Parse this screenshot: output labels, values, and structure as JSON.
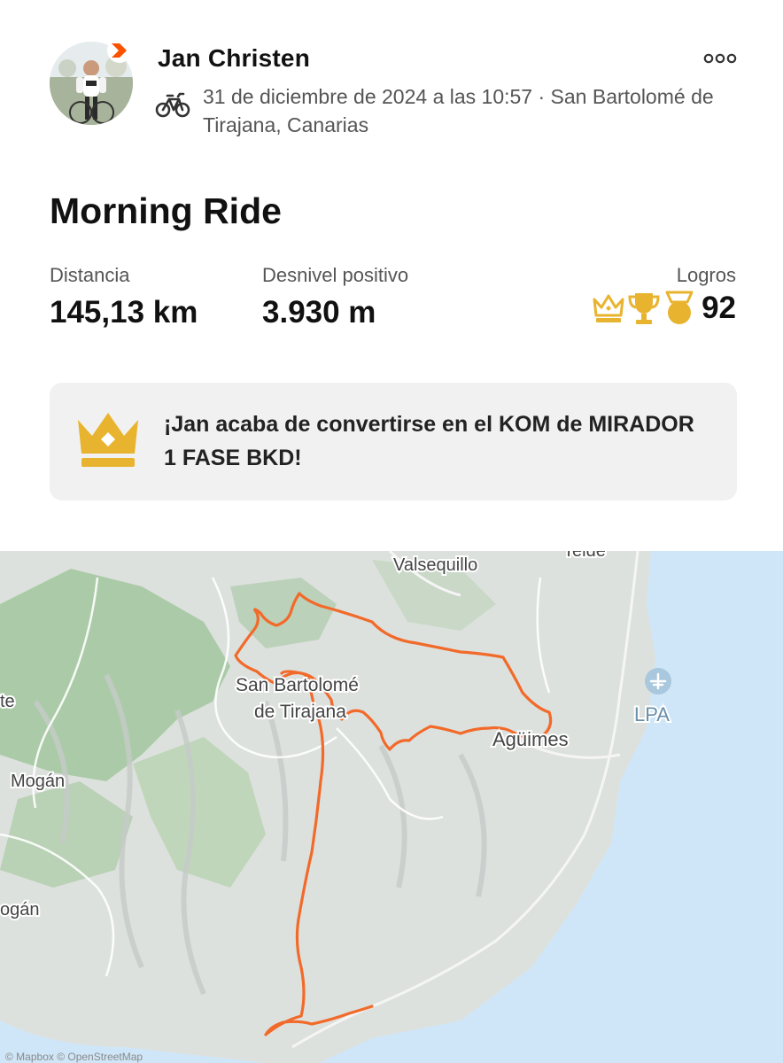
{
  "athlete": {
    "name": "Jan Christen",
    "meta": "31 de diciembre de 2024 a las 10:57 · San Bartolomé de Tirajana, Canarias"
  },
  "activity": {
    "title": "Morning Ride",
    "distance": {
      "label": "Distancia",
      "value": "145,13 km"
    },
    "elevation": {
      "label": "Desnivel positivo",
      "value": "3.930 m"
    },
    "achievements": {
      "label": "Logros",
      "count": "92",
      "icons": [
        "crown-icon",
        "trophy-icon",
        "medal-icon"
      ]
    }
  },
  "kom_banner": {
    "text": "¡Jan acaba de convertirse en el KOM de MIRADOR 1 FASE BKD!",
    "icon": "crown-icon"
  },
  "map": {
    "labels": {
      "valsequillo": "Valsequillo",
      "telde": "Telde",
      "san_bartolome_1": "San Bartolomé",
      "san_bartolome_2": "de Tirajana",
      "aguimes": "Agüimes",
      "airport": "LPA",
      "mogan_1": "Mogán",
      "mogan_2": "ogán",
      "edge": "te"
    },
    "attribution": "© Mapbox © OpenStreetMap"
  },
  "colors": {
    "brand": "#fc5200",
    "route": "#f26a2a",
    "gold": "#e8b42f",
    "sea": "#cfe6f8",
    "card": "#f1f1f1"
  }
}
